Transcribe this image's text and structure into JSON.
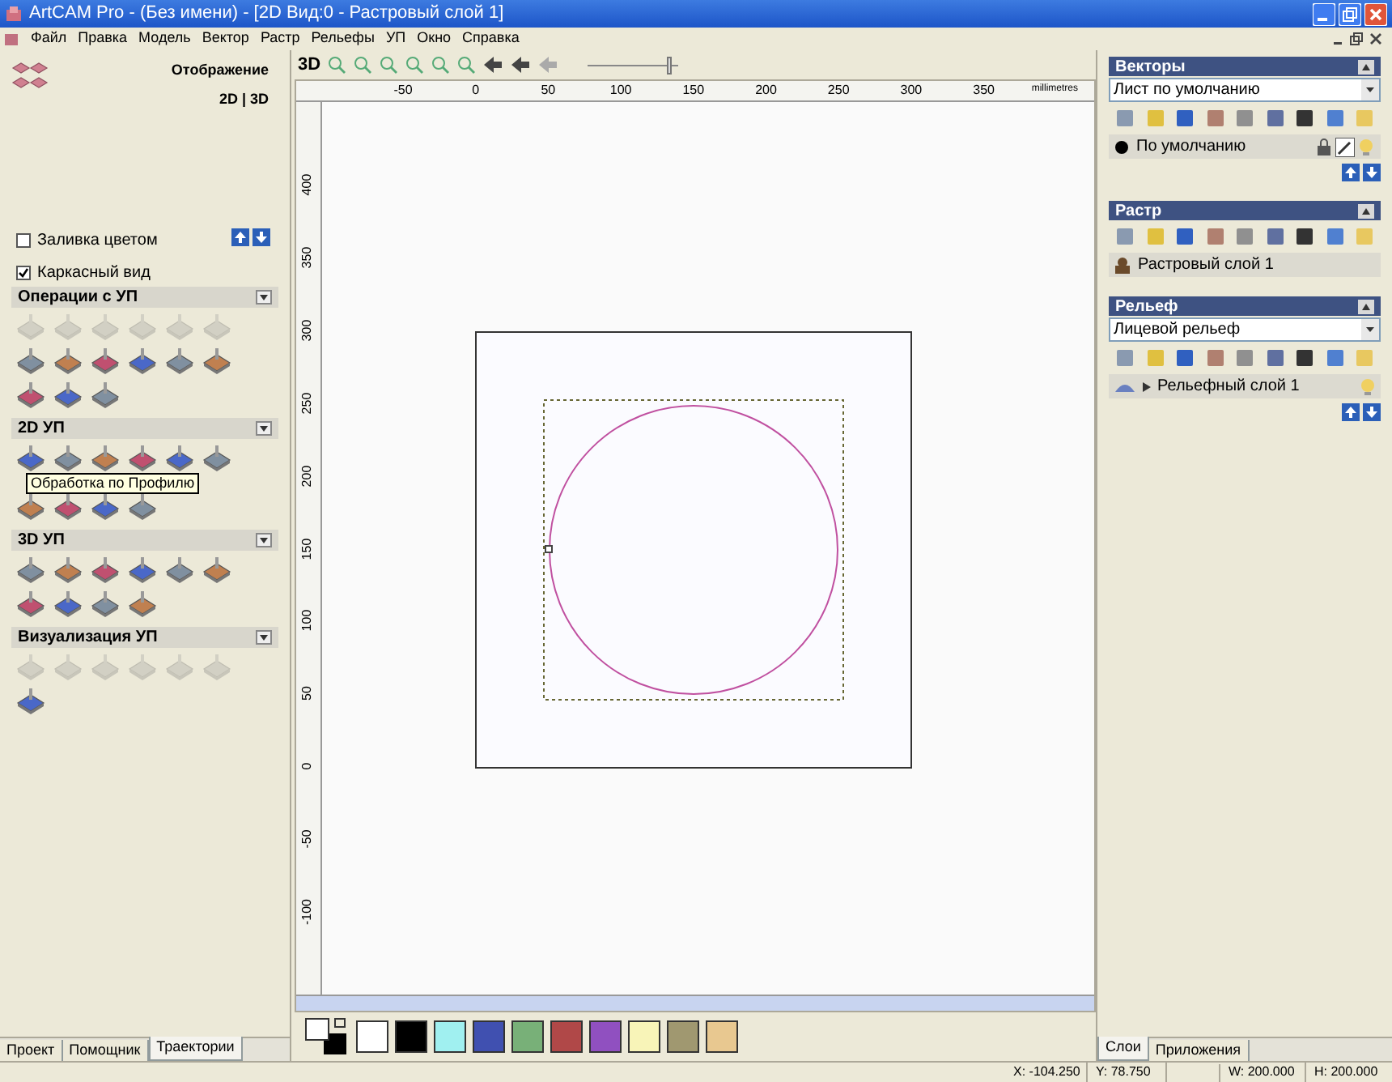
{
  "window": {
    "title": "ArtCAM Pro - (Без имени) - [2D Вид:0 - Растровый слой 1]"
  },
  "menu": [
    "Файл",
    "Правка",
    "Модель",
    "Вектор",
    "Растр",
    "Рельефы",
    "УП",
    "Окно",
    "Справка"
  ],
  "left_panel": {
    "heading": "Отображение",
    "view_toggle": "2D | 3D",
    "options": [
      {
        "label": "Заливка цветом",
        "checked": false
      },
      {
        "label": "Каркасный вид",
        "checked": true
      }
    ],
    "sections": [
      {
        "title": "Операции с УП",
        "tools": [
          {
            "disabled": true
          },
          {
            "disabled": true
          },
          {
            "disabled": true
          },
          {
            "disabled": true
          },
          {
            "disabled": true
          },
          {
            "disabled": true
          },
          {
            "disabled": false
          },
          {
            "disabled": false
          },
          {
            "disabled": false
          },
          {
            "disabled": false
          },
          {
            "disabled": false
          },
          {
            "disabled": false
          },
          {
            "disabled": false
          },
          {
            "disabled": false
          },
          {
            "disabled": false
          }
        ]
      },
      {
        "title": "2D УП",
        "tooltip": "Обработка по Профилю",
        "tools": [
          {
            "disabled": false
          },
          {
            "disabled": false
          },
          {
            "disabled": false
          },
          {
            "disabled": false
          },
          {
            "disabled": false
          },
          {
            "disabled": false
          },
          {
            "disabled": false
          },
          {
            "disabled": false
          },
          {
            "disabled": false
          },
          {
            "disabled": false
          }
        ]
      },
      {
        "title": "3D УП",
        "tools": [
          {
            "disabled": false
          },
          {
            "disabled": false
          },
          {
            "disabled": false
          },
          {
            "disabled": false
          },
          {
            "disabled": false
          },
          {
            "disabled": false
          },
          {
            "disabled": false
          },
          {
            "disabled": false
          },
          {
            "disabled": false
          },
          {
            "disabled": false
          }
        ]
      },
      {
        "title": "Визуализация УП",
        "tools": [
          {
            "disabled": true
          },
          {
            "disabled": true
          },
          {
            "disabled": true
          },
          {
            "disabled": true
          },
          {
            "disabled": true
          },
          {
            "disabled": true
          },
          {
            "disabled": false
          }
        ]
      }
    ],
    "tabs": [
      {
        "label": "Проект",
        "selected": false
      },
      {
        "label": "Помощник",
        "selected": false
      },
      {
        "label": "Траектории",
        "selected": true
      }
    ]
  },
  "view_toolbar": {
    "mode_label": "3D",
    "zoom": {
      "level": 0.93
    }
  },
  "ruler": {
    "units": "millimetres",
    "x_labels": [
      "-50",
      "0",
      "50",
      "100",
      "150",
      "200",
      "250",
      "300",
      "350"
    ],
    "y_labels": [
      "400",
      "350",
      "300",
      "250",
      "200",
      "150",
      "100",
      "50",
      "0",
      "-50",
      "-100"
    ]
  },
  "palette": [
    {
      "color": "#ffffff"
    },
    {
      "color": "#000000"
    },
    {
      "color": "#a0f0f0"
    },
    {
      "color": "#4050b0"
    },
    {
      "color": "#78b078"
    },
    {
      "color": "#b04848"
    },
    {
      "color": "#9050c0"
    },
    {
      "color": "#f8f4b8"
    },
    {
      "color": "#a09870"
    },
    {
      "color": "#e8c890"
    }
  ],
  "right_panel": {
    "vectors": {
      "title": "Векторы",
      "dropdown": "Лист по умолчанию",
      "layers": [
        {
          "name": "По умолчанию"
        }
      ]
    },
    "raster": {
      "title": "Растр",
      "layers": [
        {
          "name": "Растровый слой 1"
        }
      ]
    },
    "relief": {
      "title": "Рельеф",
      "dropdown": "Лицевой рельеф",
      "layers": [
        {
          "name": "Рельефный слой 1"
        }
      ]
    },
    "tabs": [
      {
        "label": "Слои",
        "selected": true
      },
      {
        "label": "Приложения",
        "selected": false
      }
    ]
  },
  "status_bar": {
    "x": "X: -104.250",
    "y": "Y: 78.750",
    "w": "W: 200.000",
    "h": "H: 200.000"
  }
}
